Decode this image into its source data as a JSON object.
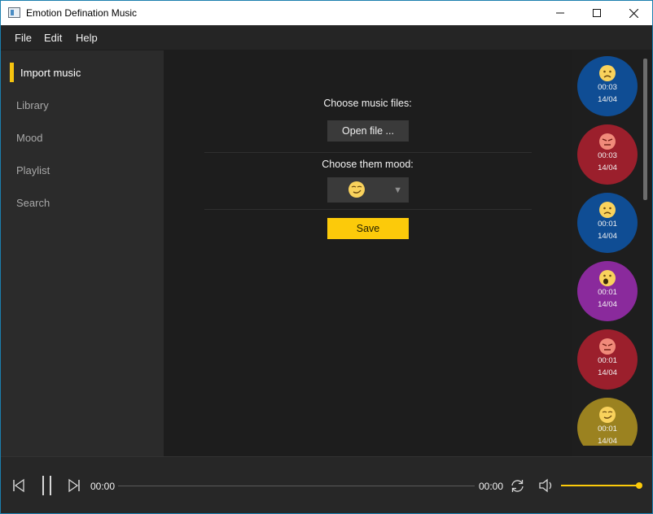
{
  "window": {
    "title": "Emotion Defination Music"
  },
  "menu": [
    "File",
    "Edit",
    "Help"
  ],
  "sidebar": {
    "items": [
      {
        "label": "Import music",
        "active": true
      },
      {
        "label": "Library",
        "active": false
      },
      {
        "label": "Mood",
        "active": false
      },
      {
        "label": "Playlist",
        "active": false
      },
      {
        "label": "Search",
        "active": false
      }
    ]
  },
  "main": {
    "choose_files_label": "Choose music files:",
    "open_file_label": "Open file ...",
    "choose_mood_label": "Choose them mood:",
    "selected_mood_icon": "smirk-face-icon",
    "save_label": "Save"
  },
  "history": [
    {
      "mood_icon": "sad-face-icon",
      "color": "#0f4d94",
      "duration": "00:03",
      "date": "14/04"
    },
    {
      "mood_icon": "angry-face-icon",
      "color": "#9b1f2c",
      "duration": "00:03",
      "date": "14/04"
    },
    {
      "mood_icon": "sad-face-icon",
      "color": "#0f4d94",
      "duration": "00:01",
      "date": "14/04"
    },
    {
      "mood_icon": "surprised-face-icon",
      "color": "#8a2a9c",
      "duration": "00:01",
      "date": "14/04"
    },
    {
      "mood_icon": "angry-face-icon",
      "color": "#9b1f2c",
      "duration": "00:01",
      "date": "14/04"
    },
    {
      "mood_icon": "smirk-face-icon",
      "color": "#9b8220",
      "duration": "00:01",
      "date": "14/04"
    }
  ],
  "player": {
    "current_time": "00:00",
    "total_time": "00:00",
    "progress": 0,
    "volume": 1.0
  },
  "colors": {
    "accent": "#fcca0a",
    "sidebar_bg": "#2b2b2b",
    "content_bg": "#1d1d1d"
  }
}
